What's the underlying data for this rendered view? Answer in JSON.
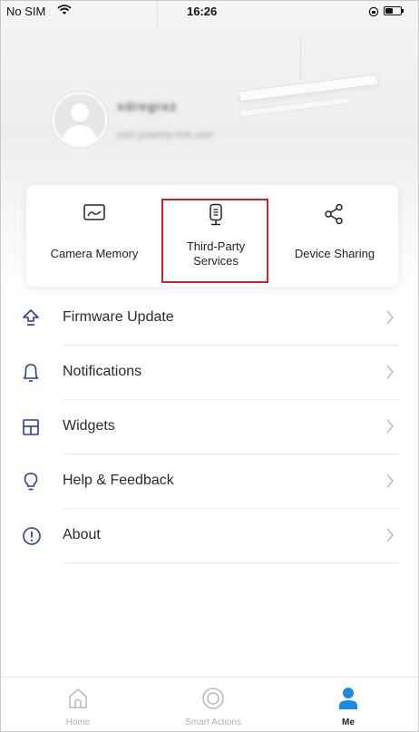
{
  "status_bar": {
    "carrier": "No SIM",
    "time": "16:26"
  },
  "profile": {
    "username": "xdregrez",
    "email": "xdzr.yxadmy-fvrk.com"
  },
  "features": [
    {
      "label": "Camera Memory",
      "icon": "image-frame-icon"
    },
    {
      "label_line1": "Third-Party",
      "label_line2": "Services",
      "icon": "speaker-device-icon",
      "highlighted": true
    },
    {
      "label": "Device Sharing",
      "icon": "share-icon"
    }
  ],
  "menu": [
    {
      "label": "Firmware Update",
      "icon": "upgrade-arrow-icon"
    },
    {
      "label": "Notifications",
      "icon": "bell-icon"
    },
    {
      "label": "Widgets",
      "icon": "widgets-icon"
    },
    {
      "label": "Help & Feedback",
      "icon": "lightbulb-icon"
    },
    {
      "label": "About",
      "icon": "info-icon"
    }
  ],
  "tabs": [
    {
      "label": "Home",
      "icon": "home-icon",
      "active": false
    },
    {
      "label": "Smart Actions",
      "icon": "smart-actions-icon",
      "active": false
    },
    {
      "label": "Me",
      "icon": "person-icon",
      "active": true
    }
  ],
  "colors": {
    "accent": "#1e88e5",
    "icon_blue": "#2c3e8f",
    "highlight": "#d0202a",
    "inactive": "#b0b0b0"
  }
}
